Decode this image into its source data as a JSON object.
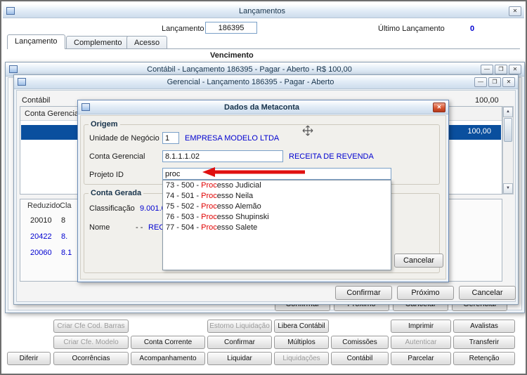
{
  "icons": {
    "close": "✕",
    "minimize": "—",
    "maximize": "❐",
    "arrow_up": "▲",
    "arrow_down": "▼"
  },
  "colors": {
    "selection_blue": "#0a4f9e",
    "link_blue": "#0000d0",
    "match_red": "#e00000",
    "arrow_red": "#e01010",
    "disabled_gray": "#9b9b9b"
  },
  "main_window": {
    "title": "Lançamentos",
    "fields": {
      "lancamento_label": "Lançamento",
      "lancamento_value": "186395",
      "ultimo_lancamento_label": "Último Lançamento",
      "ultimo_lancamento_value": "0"
    },
    "tabs": [
      {
        "label": "Lançamento",
        "active": true
      },
      {
        "label": "Complemento",
        "active": false
      },
      {
        "label": "Acesso",
        "active": false
      }
    ],
    "vencimento_label": "Vencimento"
  },
  "contabil_window": {
    "title": "Contábil -  Lançamento 186395 - Pagar - Aberto - R$ 100,00",
    "partial_buttons": [
      "Confirmar",
      "Próximo",
      "Cancelar",
      "Gerencial"
    ]
  },
  "gerencial_window": {
    "title": "Gerencial -  Lançamento 186395 - Pagar - Aberto",
    "contabil_label": "Contábil",
    "total_value": "100,00",
    "grid_header": "Conta Gerencial",
    "selected_row_value": "100,00",
    "list": {
      "headers": [
        "Reduzido",
        "Cla"
      ],
      "rows": [
        {
          "reduzido": "20010",
          "cla": "8",
          "highlight": false
        },
        {
          "reduzido": "20422",
          "cla": "8.",
          "highlight": true
        },
        {
          "reduzido": "20060",
          "cla": "8.1",
          "highlight": true
        }
      ]
    },
    "buttons": [
      "Confirmar",
      "Próximo",
      "Cancelar"
    ]
  },
  "metaconta_dialog": {
    "title": "Dados da Metaconta",
    "origem": {
      "group_label": "Origem",
      "unidade_label": "Unidade de Negócio",
      "unidade_value": "1",
      "unidade_desc": "EMPRESA MODELO LTDA",
      "conta_label": "Conta Gerencial",
      "conta_value": "8.1.1.1.02",
      "conta_desc": "RECEITA DE REVENDA",
      "projeto_label": "Projeto ID",
      "projeto_value": "proc"
    },
    "dropdown": [
      {
        "prefix": "73 - 500 - ",
        "match": "Proc",
        "suffix": "esso Judicial"
      },
      {
        "prefix": "74 - 501 - ",
        "match": "Proc",
        "suffix": "esso Neila"
      },
      {
        "prefix": "75 - 502 - ",
        "match": "Proc",
        "suffix": "esso Alemão"
      },
      {
        "prefix": "76 - 503 - ",
        "match": "Proc",
        "suffix": "esso Shupinski"
      },
      {
        "prefix": "77 - 504 - ",
        "match": "Proc",
        "suffix": "esso Salete"
      }
    ],
    "conta_gerada": {
      "group_label": "Conta Gerada",
      "classificacao_label": "Classificação",
      "classificacao_value": "9.001.0",
      "nome_label": "Nome",
      "nome_prefix": "- -",
      "nome_value": "REC"
    },
    "cancel_button": "Cancelar"
  },
  "footer": {
    "row1": [
      "Criar Cfe Cod. Barras",
      "Estorno Liquidação",
      "Libera Contábil",
      "Imprimir",
      "Avalistas"
    ],
    "row2": [
      "Criar Cfe. Modelo",
      "Conta Corrente",
      "Confirmar",
      "Múltiplos",
      "Comissões",
      "Autenticar",
      "Transferir"
    ],
    "row3": [
      "Diferir",
      "Ocorrências",
      "Acompanhamento",
      "Liquidar",
      "Liquidações",
      "Contábil",
      "Parcelar",
      "Retenção"
    ]
  }
}
